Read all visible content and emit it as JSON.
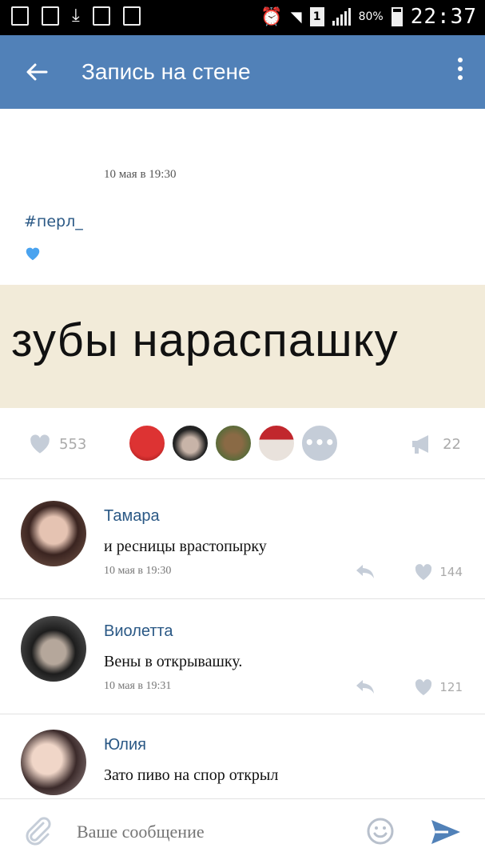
{
  "status_bar": {
    "battery_percent": "80%",
    "time": "22:37",
    "sim_label": "1"
  },
  "app_bar": {
    "title": "Запись на стене",
    "back_icon": "arrow-left-icon",
    "more_icon": "more-vertical-icon"
  },
  "post": {
    "date": "10 мая в 19:30",
    "hashtag": "#перл_",
    "emoji": "blue-heart",
    "image_text": "зубы нараспашку",
    "likes": "553",
    "shares": "22",
    "more_likers_label": "•••"
  },
  "comments": [
    {
      "author": "Тамара",
      "text": "и ресницы врастопырку",
      "date": "10 мая в 19:30",
      "likes": "144"
    },
    {
      "author": "Виолетта",
      "text": "Вены в открывашку.",
      "date": "10 мая в 19:31",
      "likes": "121"
    },
    {
      "author": "Юлия",
      "text": "Зато пиво на спор открыл",
      "date": "",
      "likes": ""
    }
  ],
  "composer": {
    "placeholder": "Ваше сообщение"
  },
  "colors": {
    "brand": "#5181b8",
    "link": "#2a5885"
  }
}
